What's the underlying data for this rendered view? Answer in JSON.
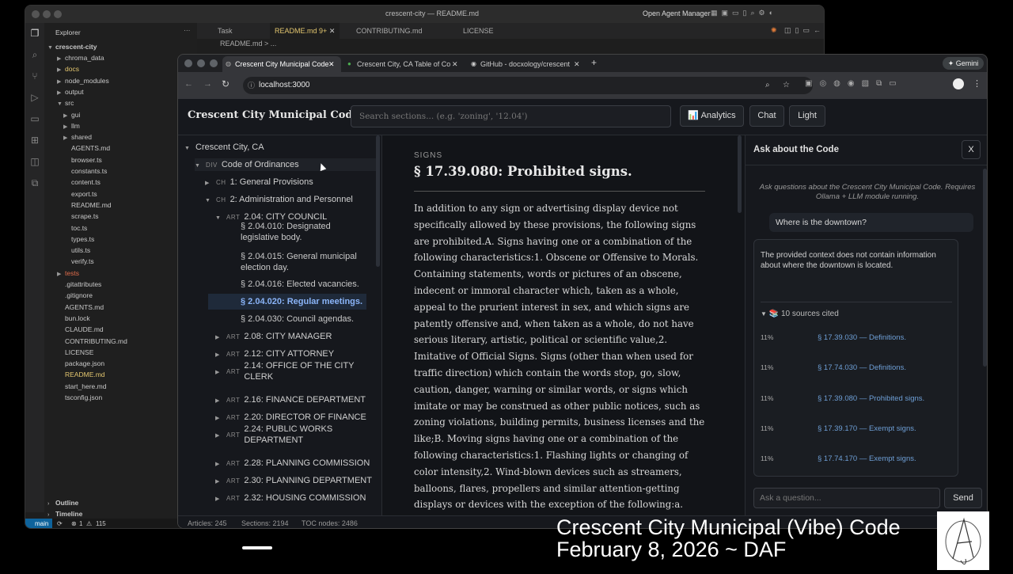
{
  "vscode": {
    "window_title": "crescent-city — README.md",
    "agent_manager": "Open Agent Manager",
    "explorer_label": "Explorer",
    "project": "crescent-city",
    "tabs": [
      "Task",
      "README.md",
      "9+",
      "CONTRIBUTING.md",
      "LICENSE"
    ],
    "breadcrumb": "README.md > ...",
    "tree": [
      {
        "label": "chroma_data",
        "kind": "folder",
        "depth": 1
      },
      {
        "label": "docs",
        "kind": "folder",
        "depth": 1
      },
      {
        "label": "node_modules",
        "kind": "folder",
        "depth": 1
      },
      {
        "label": "output",
        "kind": "folder",
        "depth": 1
      },
      {
        "label": "src",
        "kind": "folder-open",
        "depth": 1
      },
      {
        "label": "gui",
        "kind": "folder",
        "depth": 2
      },
      {
        "label": "llm",
        "kind": "folder",
        "depth": 2
      },
      {
        "label": "shared",
        "kind": "folder",
        "depth": 2
      },
      {
        "label": "AGENTS.md",
        "kind": "file",
        "depth": 2
      },
      {
        "label": "browser.ts",
        "kind": "file",
        "depth": 2
      },
      {
        "label": "constants.ts",
        "kind": "file",
        "depth": 2
      },
      {
        "label": "content.ts",
        "kind": "file",
        "depth": 2
      },
      {
        "label": "export.ts",
        "kind": "file",
        "depth": 2
      },
      {
        "label": "README.md",
        "kind": "file",
        "depth": 2
      },
      {
        "label": "scrape.ts",
        "kind": "file",
        "depth": 2
      },
      {
        "label": "toc.ts",
        "kind": "file",
        "depth": 2
      },
      {
        "label": "types.ts",
        "kind": "file",
        "depth": 2
      },
      {
        "label": "utils.ts",
        "kind": "file",
        "depth": 2
      },
      {
        "label": "verify.ts",
        "kind": "file",
        "depth": 2
      },
      {
        "label": "tests",
        "kind": "folder",
        "depth": 1
      },
      {
        "label": ".gitattributes",
        "kind": "file",
        "depth": 1
      },
      {
        "label": ".gitignore",
        "kind": "file",
        "depth": 1
      },
      {
        "label": "AGENTS.md",
        "kind": "file",
        "depth": 1
      },
      {
        "label": "bun.lock",
        "kind": "file",
        "depth": 1
      },
      {
        "label": "CLAUDE.md",
        "kind": "file",
        "depth": 1
      },
      {
        "label": "CONTRIBUTING.md",
        "kind": "file",
        "depth": 1
      },
      {
        "label": "LICENSE",
        "kind": "file",
        "depth": 1
      },
      {
        "label": "package.json",
        "kind": "file",
        "depth": 1
      },
      {
        "label": "README.md",
        "kind": "file",
        "depth": 1
      },
      {
        "label": "start_here.md",
        "kind": "file",
        "depth": 1
      },
      {
        "label": "tsconfig.json",
        "kind": "file",
        "depth": 1
      }
    ],
    "outline_label": "Outline",
    "timeline_label": "Timeline",
    "status": {
      "branch": "main",
      "errors": "1",
      "warnings": "115"
    }
  },
  "browser": {
    "tabs": [
      "Crescent City Municipal Code",
      "Crescent City, CA Table of Co",
      "GitHub - docxology/crescent"
    ],
    "gemini": "Gemini",
    "url": "localhost:3000"
  },
  "app": {
    "title": "Crescent City Municipal Code",
    "search_placeholder": "Search sections... (e.g. 'zoning', '12.04')",
    "analytics": "Analytics",
    "chat": "Chat",
    "light": "Light",
    "toc": {
      "root": "Crescent City, CA",
      "div_tag": "DIV",
      "div_label": "Code of Ordinances",
      "ch1": "1: General Provisions",
      "ch2": "2: Administration and Personnel",
      "ch_tag": "CH",
      "art_tag": "ART",
      "art204": "2.04: CITY COUNCIL",
      "sections": [
        "§ 2.04.010: Designated legislative body.",
        "§ 2.04.015: General municipal election day.",
        "§ 2.04.016: Elected vacancies.",
        "§ 2.04.020: Regular meetings.",
        "§ 2.04.030: Council agendas."
      ],
      "articles": [
        "2.08: CITY MANAGER",
        "2.12: CITY ATTORNEY",
        "2.14: OFFICE OF THE CITY CLERK",
        "2.16: FINANCE DEPARTMENT",
        "2.20: DIRECTOR OF FINANCE",
        "2.24: PUBLIC WORKS DEPARTMENT",
        "2.28: PLANNING COMMISSION",
        "2.30: PLANNING DEPARTMENT",
        "2.32: HOUSING COMMISSION"
      ]
    },
    "section": {
      "kicker": "SIGNS",
      "title": "§ 17.39.080: Prohibited signs.",
      "body": "In addition to any sign or advertising display device not specifically allowed by these provisions, the following signs are prohibited.A. Signs having one or a combination of the following characteristics:1. Obscene or Offensive to Morals. Containing statements, words or pictures of an obscene, indecent or immoral character which, taken as a whole, appeal to the prurient interest in sex, and which signs are patently offensive and, when taken as a whole, do not have serious literary, artistic, political or scientific value,2. Imitative of Official Signs. Signs (other than when used for traffic direction) which contain the words stop, go, slow, caution, danger, warning or similar words, or signs which imitate or may be construed as other public notices, such as zoning violations, building permits, business licenses and the like;B. Moving signs having one or a combination of the following characteristics:1. Flashing lights or changing of color intensity,2. Wind-blown devices such as streamers, balloons, flares, propellers and similar attention-getting displays or devices with the exception of the following:a. National, state and/or local government flags properly displayed and maintained upon a permanently mounted flagpole or bracket,b. One"
    },
    "chat_panel": {
      "title": "Ask about the Code",
      "close": "X",
      "hint": "Ask questions about the Crescent City Municipal Code. Requires Ollama + LLM module running.",
      "user_msg": "Where is the downtown?",
      "bot_msg": "The provided context does not contain information about where the downtown is located.",
      "sources_label": "10 sources cited",
      "sources": [
        {
          "pct": "11%",
          "ref": "§ 17.39.030 — Definitions."
        },
        {
          "pct": "11%",
          "ref": "§ 17.74.030 — Definitions."
        },
        {
          "pct": "11%",
          "ref": "§ 17.39.080 — Prohibited signs."
        },
        {
          "pct": "11%",
          "ref": "§ 17.39.170 — Exempt signs."
        },
        {
          "pct": "11%",
          "ref": "§ 17.74.170 — Exempt signs."
        }
      ],
      "input_placeholder": "Ask a question...",
      "send": "Send"
    },
    "footer": {
      "articles": "Articles: 245",
      "sections": "Sections: 2194",
      "toc": "TOC nodes: 2486"
    }
  },
  "caption": {
    "line1": "Crescent City Municipal (Vibe) Code",
    "line2": "February 8, 2026 ~ DAF"
  },
  "colors": {
    "accent_link": "#6e9fd6",
    "active_section": "#8ab4f8",
    "status_bar": "#181818"
  }
}
